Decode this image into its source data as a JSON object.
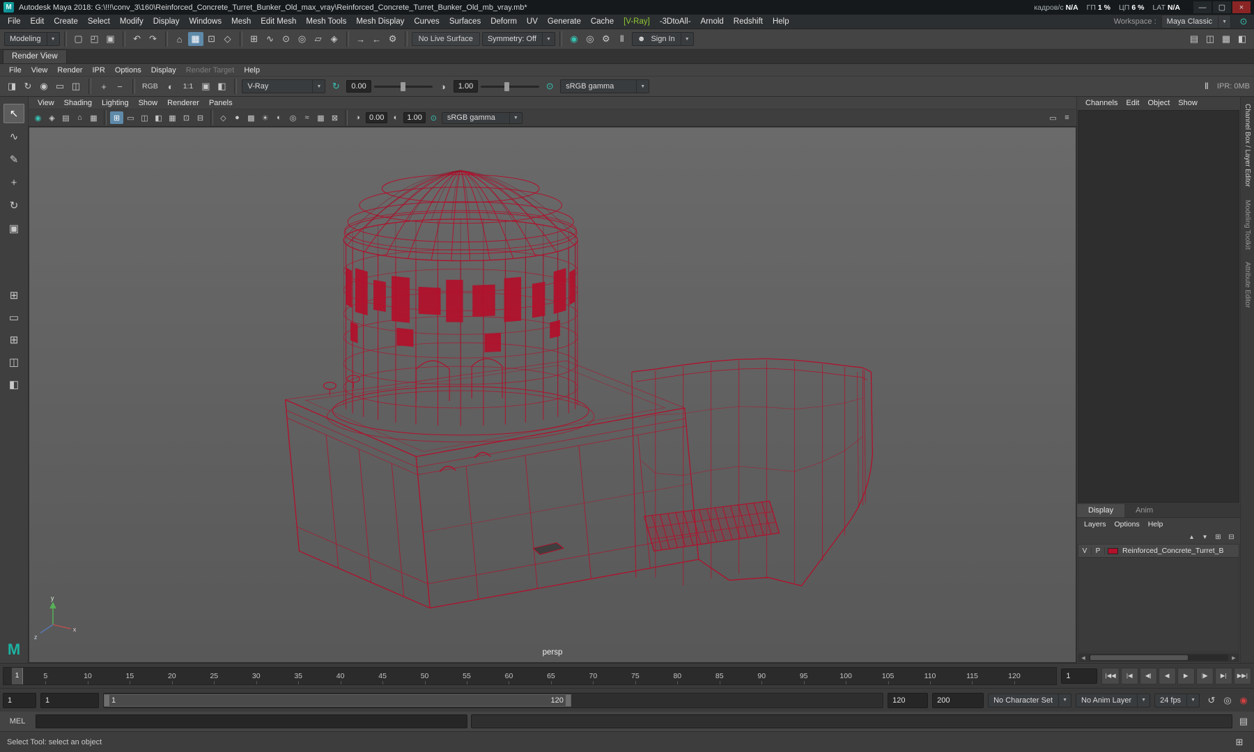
{
  "window": {
    "title": "Autodesk Maya 2018: G:\\!!!\\conv_3\\160\\Reinforced_Concrete_Turret_Bunker_Old_max_vray\\Reinforced_Concrete_Turret_Bunker_Old_mb_vray.mb*",
    "controls": {
      "minimize": "—",
      "maximize": "▢",
      "close": "×"
    },
    "perf": [
      {
        "label": "кадров/с",
        "value": "N/A"
      },
      {
        "label": "ГП",
        "value": "1 %"
      },
      {
        "label": "ЦП",
        "value": "6 %"
      },
      {
        "label": "LAT",
        "value": "N/A"
      }
    ]
  },
  "menubar": {
    "items": [
      "File",
      "Edit",
      "Create",
      "Select",
      "Modify",
      "Display",
      "Windows",
      "Mesh",
      "Edit Mesh",
      "Mesh Tools",
      "Mesh Display",
      "Curves",
      "Surfaces",
      "Deform",
      "UV",
      "Generate",
      "Cache",
      {
        "label": "[V-Ray]",
        "color": "#8fc832"
      },
      "-3DtoAll-",
      "Arnold",
      "Redshift",
      "Help"
    ],
    "workspace_label": "Workspace :",
    "workspace_value": "Maya Classic"
  },
  "statusline": {
    "mode": "Modeling",
    "file_icons": [
      {
        "name": "new-scene-icon",
        "glyph": "▢"
      },
      {
        "name": "open-scene-icon",
        "glyph": "◰"
      },
      {
        "name": "save-scene-icon",
        "glyph": "▣"
      }
    ],
    "history_icons": [
      {
        "name": "undo-icon",
        "glyph": "↶"
      },
      {
        "name": "redo-icon",
        "glyph": "↷"
      }
    ],
    "selection_icons": [
      {
        "name": "select-hierarchy-icon",
        "glyph": "⌂"
      },
      {
        "name": "select-object-icon",
        "glyph": "▦",
        "active": true
      },
      {
        "name": "select-component-icon",
        "glyph": "⊡"
      },
      {
        "name": "highlight-selection-icon",
        "glyph": "◇"
      }
    ],
    "snap_icons": [
      {
        "name": "snap-grid-icon",
        "glyph": "⊞"
      },
      {
        "name": "snap-curve-icon",
        "glyph": "∿"
      },
      {
        "name": "snap-point-icon",
        "glyph": "⊙"
      },
      {
        "name": "snap-projected-center-icon",
        "glyph": "◎"
      },
      {
        "name": "snap-view-plane-icon",
        "glyph": "▱"
      },
      {
        "name": "make-live-icon",
        "glyph": "◈"
      }
    ],
    "connection_icons": [
      {
        "name": "input-connections-icon",
        "glyph": "→"
      },
      {
        "name": "output-connections-icon",
        "glyph": "←"
      },
      {
        "name": "construction-history-icon",
        "glyph": "⚙"
      }
    ],
    "live_surface": "No Live Surface",
    "symmetry": "Symmetry: Off",
    "render_icons": [
      {
        "name": "render-frame-icon",
        "glyph": "◉",
        "cls": "teal"
      },
      {
        "name": "ipr-render-icon",
        "glyph": "◎"
      },
      {
        "name": "render-settings-icon",
        "glyph": "⚙"
      },
      {
        "name": "pause-icon",
        "glyph": "Ⅱ"
      }
    ],
    "signin": "Sign In",
    "panel_icons": [
      {
        "name": "single-pane-icon",
        "glyph": "▤"
      },
      {
        "name": "two-pane-icon",
        "glyph": "◫"
      },
      {
        "name": "four-pane-icon",
        "glyph": "▦"
      },
      {
        "name": "outliner-pane-icon",
        "glyph": "◧"
      }
    ]
  },
  "renderview": {
    "tab": "Render View",
    "menus": [
      {
        "label": "File"
      },
      {
        "label": "View"
      },
      {
        "label": "Render"
      },
      {
        "label": "IPR"
      },
      {
        "label": "Options"
      },
      {
        "label": "Display"
      },
      {
        "label": "Render Target",
        "disabled": true
      },
      {
        "label": "Help"
      }
    ],
    "toolbar": {
      "icons_a": [
        {
          "name": "render-scene-icon",
          "glyph": "◨"
        },
        {
          "name": "redo-previous-render-icon",
          "glyph": "↻"
        },
        {
          "name": "ipr-render-icon",
          "glyph": "◉"
        },
        {
          "name": "region-render-icon",
          "glyph": "▭"
        },
        {
          "name": "snapshot-icon",
          "glyph": "◫"
        }
      ],
      "icons_b": [
        {
          "name": "keep-image-icon",
          "glyph": "+"
        },
        {
          "name": "remove-image-icon",
          "glyph": "−"
        }
      ],
      "rgb_label": "RGB",
      "icons_c": [
        {
          "name": "alpha-channel-icon",
          "glyph": "◐"
        }
      ],
      "ratio": "1:1",
      "icons_d": [
        {
          "name": "real-size-icon",
          "glyph": "▣"
        },
        {
          "name": "frame-region-icon",
          "glyph": "◧"
        }
      ],
      "renderer": "V-Ray",
      "icons_e": [
        {
          "name": "reset-exposure-icon",
          "glyph": "↻",
          "cls": "teal"
        }
      ],
      "exposure": "0.00",
      "icons_f": [
        {
          "name": "contrast-icon",
          "glyph": "◑"
        }
      ],
      "gamma": "1.00",
      "icons_g": [
        {
          "name": "color-management-icon",
          "glyph": "⊙",
          "cls": "teal"
        }
      ],
      "colorspace": "sRGB gamma",
      "icons_h": [
        {
          "name": "ipr-pause-icon",
          "glyph": "Ⅱ"
        }
      ],
      "ipr_mem": "IPR: 0MB"
    }
  },
  "toolbox": {
    "tools": [
      {
        "name": "select-tool",
        "glyph": "↖",
        "active": true
      },
      {
        "name": "lasso-tool",
        "glyph": "∿"
      },
      {
        "name": "paint-select-tool",
        "glyph": "✎"
      },
      {
        "name": "move-tool",
        "glyph": "+"
      },
      {
        "name": "rotate-tool",
        "glyph": "↻"
      },
      {
        "name": "scale-tool",
        "glyph": "▣"
      }
    ],
    "layout_icons": [
      {
        "name": "grid-layout-icon",
        "glyph": "⊞"
      },
      {
        "name": "single-pane-layout-icon",
        "glyph": "▭"
      },
      {
        "name": "four-pane-layout-icon",
        "glyph": "⊞"
      },
      {
        "name": "side-by-side-layout-icon",
        "glyph": "◫"
      },
      {
        "name": "outliner-persp-layout-icon",
        "glyph": "◧"
      }
    ]
  },
  "panel": {
    "menus": [
      "View",
      "Shading",
      "Lighting",
      "Show",
      "Renderer",
      "Panels"
    ],
    "icons_a": [
      {
        "name": "select-camera-icon",
        "glyph": "◉",
        "cls": "teal"
      },
      {
        "name": "lock-camera-icon",
        "glyph": "◈"
      },
      {
        "name": "camera-attributes-icon",
        "glyph": "▤"
      },
      {
        "name": "bookmarks-icon",
        "glyph": "⌂"
      },
      {
        "name": "image-plane-icon",
        "glyph": "▦"
      }
    ],
    "icons_b": [
      {
        "name": "grid-icon",
        "glyph": "⊞",
        "active": true
      },
      {
        "name": "film-gate-icon",
        "glyph": "▭"
      },
      {
        "name": "resolution-gate-icon",
        "glyph": "◫"
      },
      {
        "name": "gate-mask-icon",
        "glyph": "◧"
      },
      {
        "name": "field-chart-icon",
        "glyph": "▦"
      },
      {
        "name": "safe-action-icon",
        "glyph": "⊡"
      },
      {
        "name": "safe-title-icon",
        "glyph": "⊟"
      }
    ],
    "icons_c": [
      {
        "name": "wireframe-icon",
        "glyph": "◇"
      },
      {
        "name": "smooth-shade-icon",
        "glyph": "●"
      },
      {
        "name": "textured-icon",
        "glyph": "▩"
      },
      {
        "name": "lights-icon",
        "glyph": "☀"
      },
      {
        "name": "shadows-icon",
        "glyph": "◐"
      },
      {
        "name": "ssao-icon",
        "glyph": "◎"
      },
      {
        "name": "motion-blur-icon",
        "glyph": "≈"
      },
      {
        "name": "multisample-icon",
        "glyph": "▦"
      },
      {
        "name": "xray-icon",
        "glyph": "⊠"
      }
    ],
    "icons_exp": [
      {
        "name": "exposure-icon",
        "glyph": "◑"
      }
    ],
    "icons_gamma": [
      {
        "name": "gamma-icon",
        "glyph": "◐"
      }
    ],
    "icons_cm": [
      {
        "name": "color-management-icon",
        "glyph": "⊙",
        "cls": "teal"
      }
    ],
    "exposure": "0.00",
    "gamma": "1.00",
    "colorspace": "sRGB gamma",
    "icons_right": [
      {
        "name": "isolate-select-icon",
        "glyph": "▭"
      },
      {
        "name": "panel-menu-icon",
        "glyph": "≡"
      }
    ],
    "camera_label": "persp"
  },
  "channelbox": {
    "menus": [
      "Channels",
      "Edit",
      "Object",
      "Show"
    ]
  },
  "side_tabs": [
    {
      "label": "Channel Box / Layer Editor",
      "active": true
    },
    {
      "label": "Modeling Toolkit"
    },
    {
      "label": "Attribute Editor"
    }
  ],
  "layers": {
    "tabs": [
      {
        "label": "Display",
        "active": true
      },
      {
        "label": "Anim",
        "active": false
      }
    ],
    "menus": [
      "Layers",
      "Options",
      "Help"
    ],
    "toolbar_icons": [
      {
        "name": "layer-move-up-icon",
        "glyph": "▴"
      },
      {
        "name": "layer-move-down-icon",
        "glyph": "▾"
      },
      {
        "name": "new-empty-layer-icon",
        "glyph": "⊞"
      },
      {
        "name": "new-layer-from-selected-icon",
        "glyph": "⊟"
      }
    ],
    "rows": [
      {
        "visible": "V",
        "playback": "P",
        "color": "#b3102b",
        "name": "Reinforced_Concrete_Turret_B"
      }
    ]
  },
  "timeline": {
    "current": "1",
    "current_field": "1",
    "range_min": 0,
    "range_max": 125,
    "ticks": [
      5,
      10,
      15,
      20,
      25,
      30,
      35,
      40,
      45,
      50,
      55,
      60,
      65,
      70,
      75,
      80,
      85,
      90,
      95,
      100,
      105,
      110,
      115,
      120
    ],
    "playback_icons": [
      {
        "name": "go-to-start-button",
        "glyph": "|◀◀"
      },
      {
        "name": "step-back-frame-button",
        "glyph": "|◀"
      },
      {
        "name": "step-back-key-button",
        "glyph": "◀|"
      },
      {
        "name": "play-backwards-button",
        "glyph": "◀"
      },
      {
        "name": "play-forwards-button",
        "glyph": "▶"
      },
      {
        "name": "step-forward-key-button",
        "glyph": "|▶"
      },
      {
        "name": "step-forward-frame-button",
        "glyph": "▶|"
      },
      {
        "name": "go-to-end-button",
        "glyph": "▶▶|"
      }
    ]
  },
  "range": {
    "anim_start": "1",
    "play_start": "1",
    "handle_start": "1",
    "handle_end": "120",
    "play_end": "120",
    "anim_end": "200",
    "char_set": "No Character Set",
    "anim_layer": "No Anim Layer",
    "fps": "24 fps",
    "icons": [
      {
        "name": "playback-options-icon",
        "glyph": "↺"
      },
      {
        "name": "anim-snapshot-icon",
        "glyph": "◎"
      },
      {
        "name": "auto-keyframe-icon",
        "glyph": "◉",
        "cls": "red"
      }
    ]
  },
  "command": {
    "label": "MEL"
  },
  "help": {
    "text": "Select Tool: select an object"
  },
  "colors": {
    "wire": "#b3102b",
    "wire_dark": "#871126",
    "teal": "#35c3b4",
    "accent": "#5f8aaa",
    "viewport_bg": "#5f5f5f"
  }
}
